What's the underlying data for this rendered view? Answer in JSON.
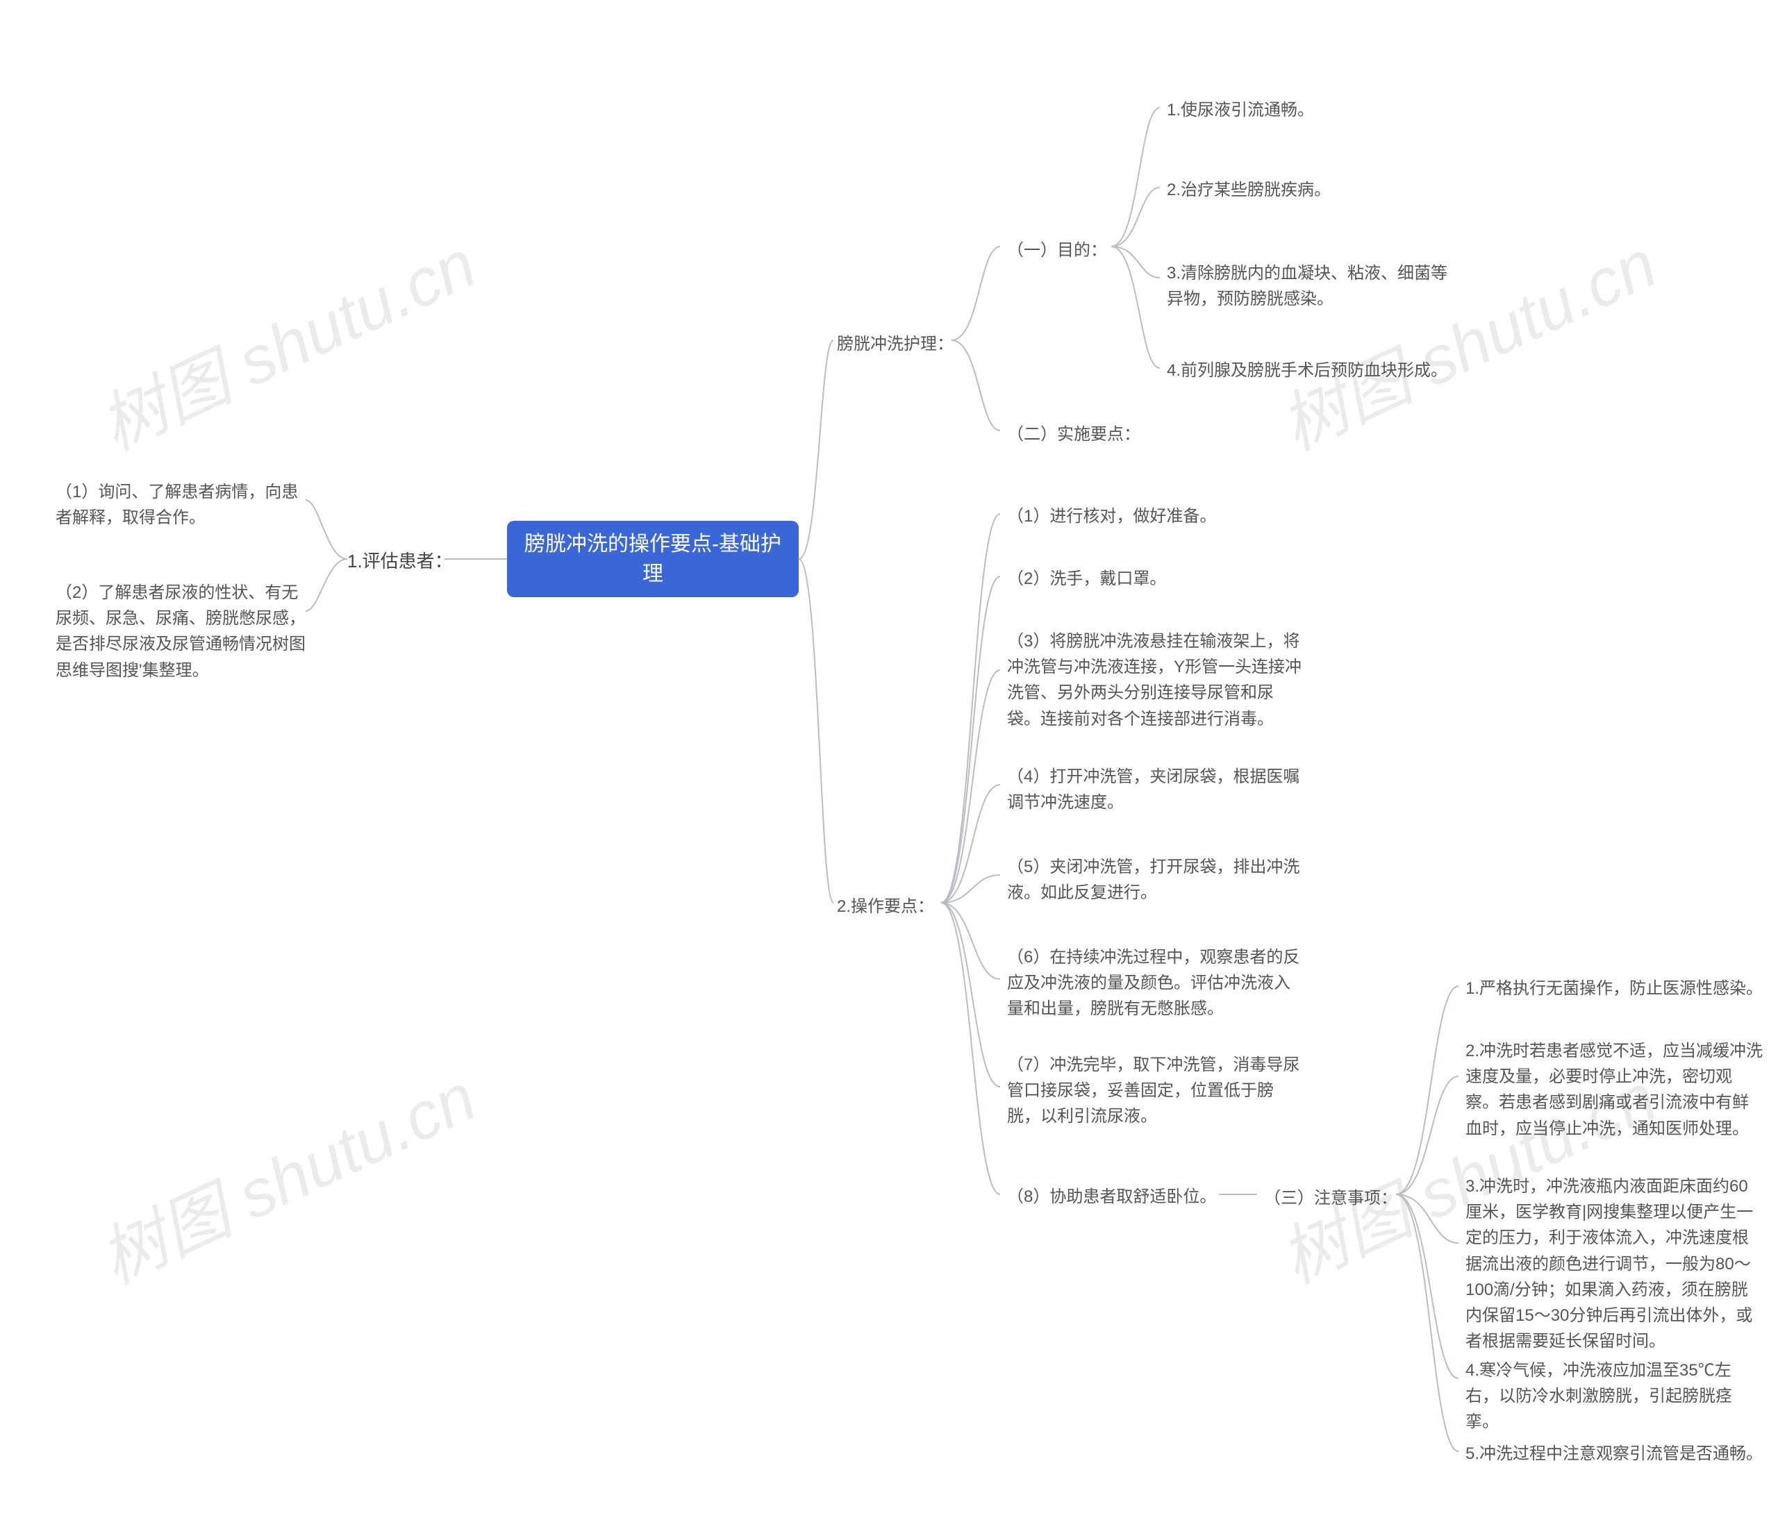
{
  "root": {
    "title": "膀胱冲洗的操作要点-基础护理"
  },
  "left": {
    "section": {
      "label": "1.评估患者："
    },
    "items": [
      "（1）询问、了解患者病情，向患者解释，取得合作。",
      "（2）了解患者尿液的性状、有无尿频、尿急、尿痛、膀胱憋尿感，是否排尽尿液及尿管通畅情况树图思维导图搜'集整理。"
    ]
  },
  "right": {
    "grp1": {
      "label": "膀胱冲洗护理：",
      "purpose": {
        "label": "（一）目的：",
        "items": [
          "1.使尿液引流通畅。",
          "2.治疗某些膀胱疾病。",
          "3.清除膀胱内的血凝块、粘液、细菌等异物，预防膀胱感染。",
          "4.前列腺及膀胱手术后预防血块形成。"
        ]
      },
      "impl": {
        "label": "（二）实施要点："
      }
    },
    "grp2": {
      "label": "2.操作要点：",
      "steps": [
        "（1）进行核对，做好准备。",
        "（2）洗手，戴口罩。",
        "（3）将膀胱冲洗液悬挂在输液架上，将冲洗管与冲洗液连接，Y形管一头连接冲洗管、另外两头分别连接导尿管和尿袋。连接前对各个连接部进行消毒。",
        "（4）打开冲洗管，夹闭尿袋，根据医嘱调节冲洗速度。",
        "（5）夹闭冲洗管，打开尿袋，排出冲洗液。如此反复进行。",
        "（6）在持续冲洗过程中，观察患者的反应及冲洗液的量及颜色。评估冲洗液入量和出量，膀胱有无憋胀感。",
        "（7）冲洗完毕，取下冲洗管，消毒导尿管口接尿袋，妥善固定，位置低于膀胱，以利引流尿液。",
        "（8）协助患者取舒适卧位。"
      ],
      "notes": {
        "label": "（三）注意事项：",
        "items": [
          "1.严格执行无菌操作，防止医源性感染。",
          "2.冲洗时若患者感觉不适，应当减缓冲洗速度及量，必要时停止冲洗，密切观察。若患者感到剧痛或者引流液中有鲜血时，应当停止冲洗，通知医师处理。",
          "3.冲洗时，冲洗液瓶内液面距床面约60厘米，医学教育|网搜集整理以便产生一定的压力，利于液体流入，冲洗速度根据流出液的颜色进行调节，一般为80～100滴/分钟；如果滴入药液，须在膀胱内保留15～30分钟后再引流出体外，或者根据需要延长保留时间。",
          "4.寒冷气候，冲洗液应加温至35℃左右，以防冷水刺激膀胱，引起膀胱痉挛。",
          "5.冲洗过程中注意观察引流管是否通畅。"
        ]
      }
    }
  },
  "watermark": "树图 shutu.cn"
}
